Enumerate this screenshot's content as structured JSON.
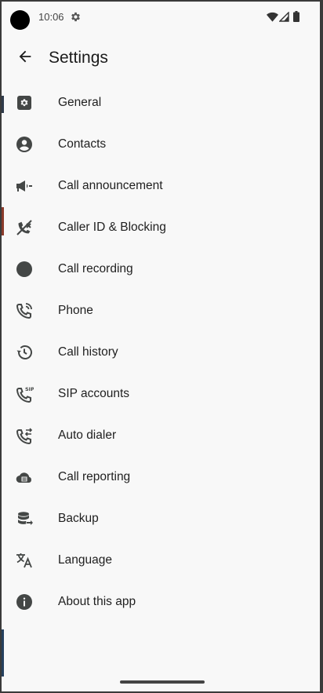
{
  "status_bar": {
    "time": "10:06",
    "icons": [
      "settings-gear-icon",
      "wifi-icon",
      "cell-signal-icon",
      "battery-icon"
    ]
  },
  "app_bar": {
    "title": "Settings",
    "back_icon": "arrow-back-icon"
  },
  "settings": {
    "items": [
      {
        "label": "General",
        "icon": "gear-icon"
      },
      {
        "label": "Contacts",
        "icon": "account-circle-icon"
      },
      {
        "label": "Call announcement",
        "icon": "megaphone-icon"
      },
      {
        "label": "Caller ID & Blocking",
        "icon": "phone-blocked-icon"
      },
      {
        "label": "Call recording",
        "icon": "record-icon"
      },
      {
        "label": "Phone",
        "icon": "phone-in-talk-icon"
      },
      {
        "label": "Call history",
        "icon": "history-icon"
      },
      {
        "label": "SIP accounts",
        "icon": "sip-phone-icon"
      },
      {
        "label": "Auto dialer",
        "icon": "phone-forward-icon"
      },
      {
        "label": "Call reporting",
        "icon": "cloud-report-icon"
      },
      {
        "label": "Backup",
        "icon": "database-export-icon"
      },
      {
        "label": "Language",
        "icon": "translate-icon"
      },
      {
        "label": "About this app",
        "icon": "info-icon"
      }
    ]
  },
  "colors": {
    "background": "#f8f8f8",
    "icon": "#444746",
    "text": "#1f1f1f"
  }
}
